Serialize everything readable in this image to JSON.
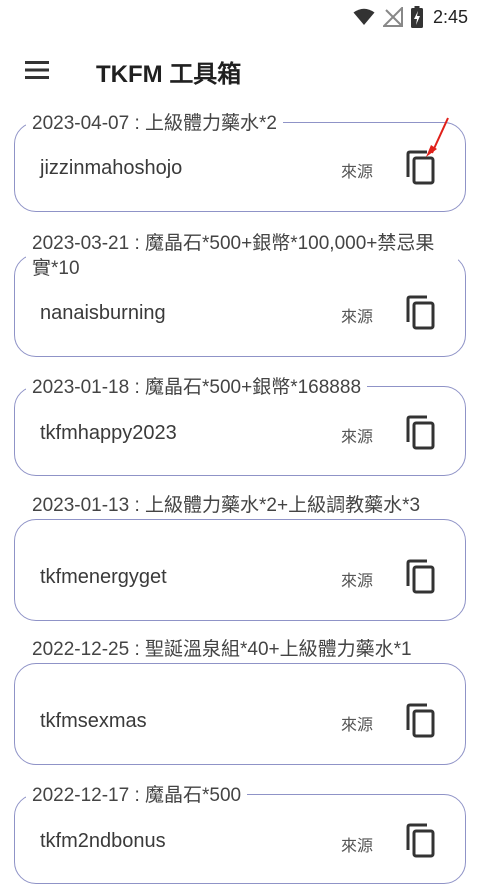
{
  "status_bar": {
    "time": "2:45"
  },
  "app_bar": {
    "title": "TKFM 工具箱"
  },
  "cards": [
    {
      "label": "2023-04-07 : 上級體力藥水*2",
      "code": "jizzinmahoshojo",
      "source": "來源"
    },
    {
      "label": "2023-03-21 : 魔晶石*500+銀幣*100,000+禁忌果實*10",
      "code": "nanaisburning",
      "source": "來源"
    },
    {
      "label": "2023-01-18 : 魔晶石*500+銀幣*168888",
      "code": "tkfmhappy2023",
      "source": "來源"
    },
    {
      "label": "2023-01-13 : 上級體力藥水*2+上級調教藥水*3",
      "code": "tkfmenergyget",
      "source": "來源"
    },
    {
      "label": "2022-12-25 : 聖誕溫泉組*40+上級體力藥水*1",
      "code": "tkfmsexmas",
      "source": "來源"
    },
    {
      "label": "2022-12-17 : 魔晶石*500",
      "code": "tkfm2ndbonus",
      "source": "來源"
    }
  ]
}
